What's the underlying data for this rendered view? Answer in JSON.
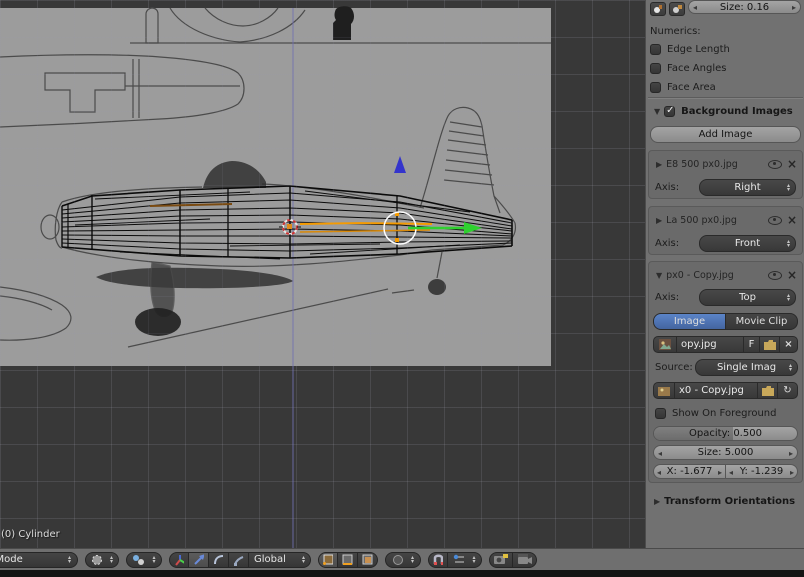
{
  "viewport": {
    "object_info": "(0) Cylinder"
  },
  "panel": {
    "normals_size": "Size: 0.16",
    "numerics_label": "Numerics:",
    "check_edge_length": "Edge Length",
    "check_face_angles": "Face Angles",
    "check_face_area": "Face Area",
    "bg_images_title": "Background Images",
    "add_image": "Add Image",
    "entry1": {
      "name": "E8 500 px0.jpg",
      "axis_label": "Axis:",
      "axis": "Right"
    },
    "entry2": {
      "name": "La 500 px0.jpg",
      "axis_label": "Axis:",
      "axis": "Front"
    },
    "entry3": {
      "name": "px0 - Copy.jpg",
      "axis_label": "Axis:",
      "axis": "Top",
      "tab_image": "Image",
      "tab_movie": "Movie Clip",
      "datablock_name": "opy.jpg",
      "fake_user": "F",
      "source_label": "Source:",
      "source_value": "Single Imag",
      "filepath": "x0 - Copy.jpg",
      "show_foreground": "Show On Foreground",
      "opacity": "Opacity: 0.500",
      "size": "Size: 5.000",
      "x_offset": "X: -1.677",
      "y_offset": "Y: -1.239"
    },
    "transform_orientations": "Transform Orientations"
  },
  "header": {
    "mode": "Edit Mode",
    "orientation": "Global"
  },
  "colors": {
    "selection_orange": "#f59b00",
    "axis_green": "#2fd12f",
    "axis_blue": "#3434cc",
    "tab_active_blue": "#4f77bd",
    "cursor_red": "#cc3333"
  }
}
